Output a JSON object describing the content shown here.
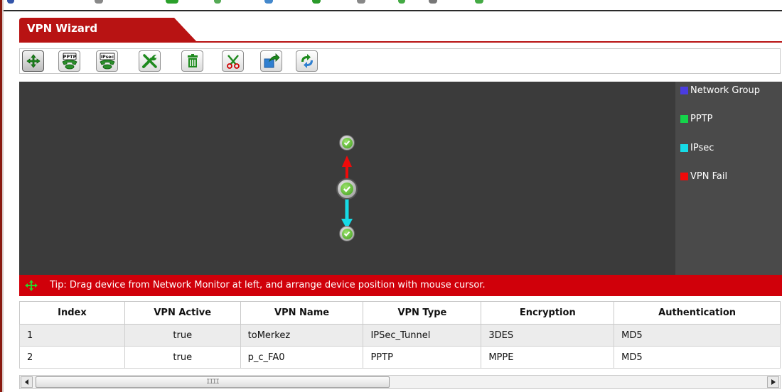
{
  "window": {
    "title": "VPN Wizard"
  },
  "toolbar": {
    "buttons": [
      {
        "name": "move-tool",
        "icon": "move-arrows-icon",
        "active": true
      },
      {
        "name": "pptp-tool",
        "icon": "pptp-phone-icon",
        "badge": "PPTP"
      },
      {
        "name": "ipsec-tool",
        "icon": "ipsec-phone-icon",
        "badge": "IPsec"
      },
      {
        "name": "edit-tool",
        "icon": "wrench-screwdriver-icon"
      },
      {
        "name": "delete-tool",
        "icon": "trash-icon"
      },
      {
        "name": "cut-tool",
        "icon": "scissors-icon"
      },
      {
        "name": "export-tool",
        "icon": "export-arrow-icon"
      },
      {
        "name": "refresh-tool",
        "icon": "refresh-icon"
      }
    ]
  },
  "legend": {
    "items": [
      {
        "label": "Network Group",
        "color": "#4a3ce0"
      },
      {
        "label": "PPTP",
        "color": "#14d44a"
      },
      {
        "label": "IPsec",
        "color": "#16dbe6"
      },
      {
        "label": "VPN Fail",
        "color": "#f00a0a"
      }
    ]
  },
  "topology": {
    "nodes": [
      "top-device",
      "center-device",
      "bottom-device"
    ],
    "links": [
      {
        "from": "center-device",
        "to": "top-device",
        "type": "VPN Fail",
        "color": "#f00a0a"
      },
      {
        "from": "center-device",
        "to": "bottom-device",
        "type": "IPsec",
        "color": "#16dbe6"
      }
    ]
  },
  "tip": {
    "text": "Tip: Drag device from Network Monitor at left, and arrange device position with mouse cursor."
  },
  "table": {
    "headers": [
      "Index",
      "VPN Active",
      "VPN Name",
      "VPN Type",
      "Encryption",
      "Authentication"
    ],
    "rows": [
      [
        "1",
        "true",
        "toMerkez",
        "IPSec_Tunnel",
        "3DES",
        "MD5"
      ],
      [
        "2",
        "true",
        "p_c_FA0",
        "PPTP",
        "MPPE",
        "MD5"
      ]
    ]
  },
  "scrollbar": {
    "grip": "IIII"
  },
  "colors": {
    "accent": "#b81313",
    "tip_bg": "#d0000a",
    "canvas_bg": "#3b3b3b",
    "legend_bg": "#4a4a4a"
  }
}
